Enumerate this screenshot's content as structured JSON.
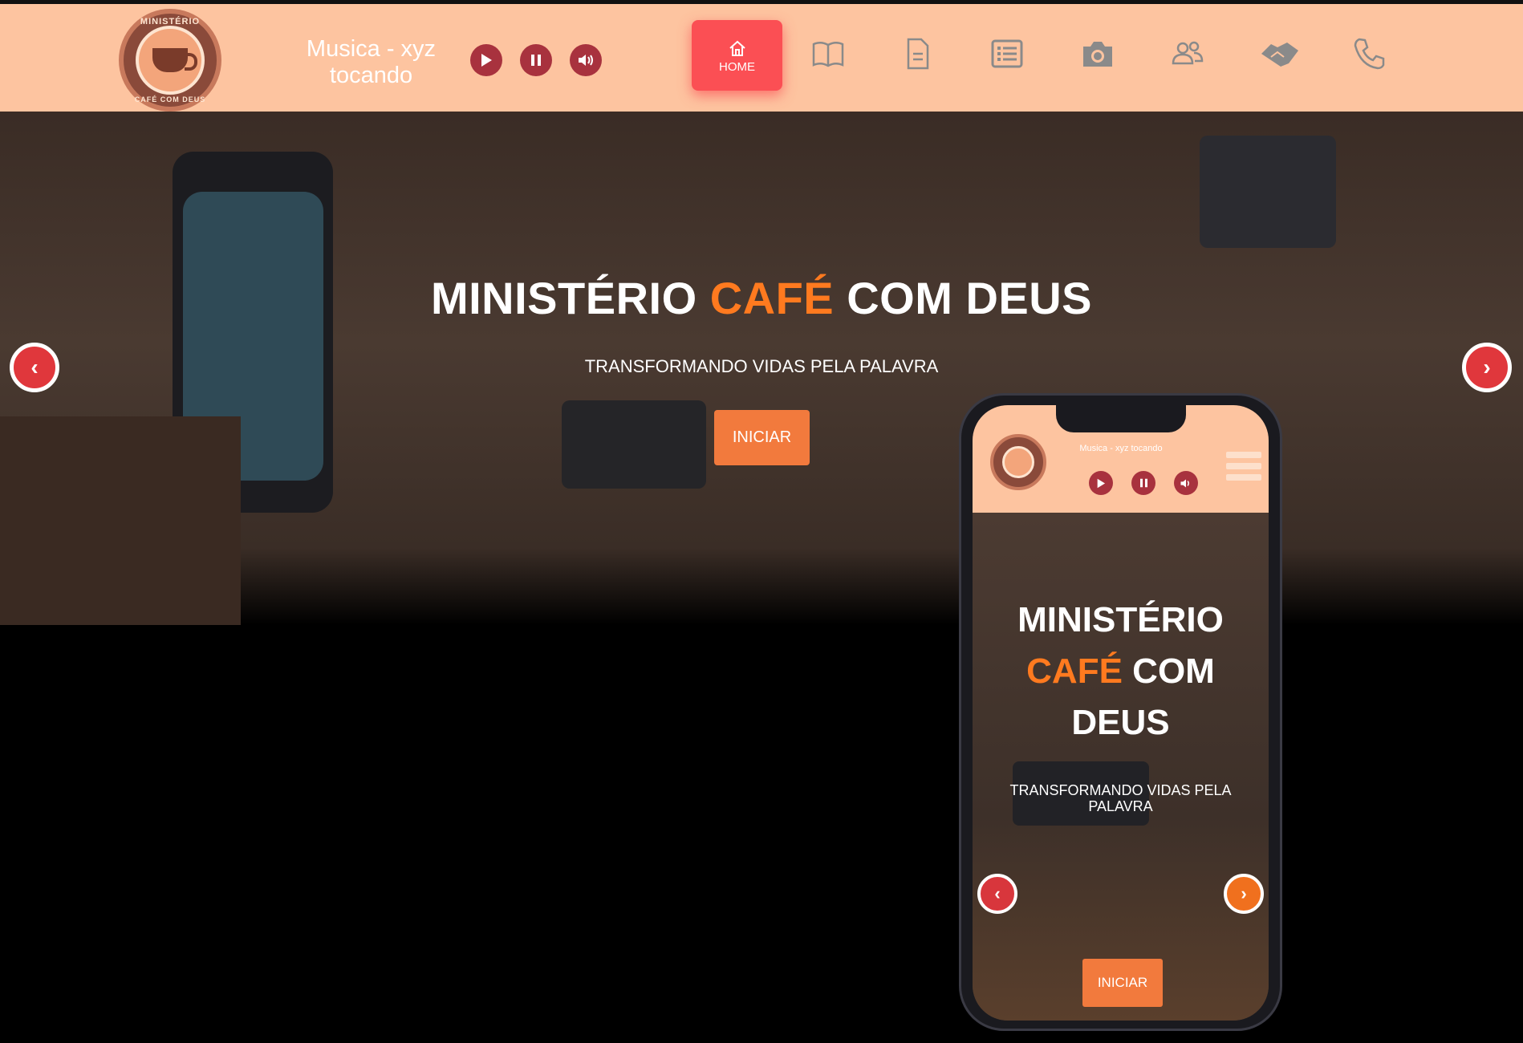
{
  "header": {
    "logo_top_text": "MINISTÉRIO",
    "logo_bottom_text": "CAFÉ COM DEUS",
    "now_playing": "Musica - xyz tocando",
    "controls": {
      "play_icon": "play-icon",
      "pause_icon": "pause-icon",
      "volume_icon": "volume-icon"
    },
    "nav": [
      {
        "label": "HOME",
        "icon": "home-icon",
        "active": true
      },
      {
        "label": "",
        "icon": "book-icon"
      },
      {
        "label": "",
        "icon": "document-icon"
      },
      {
        "label": "",
        "icon": "list-icon"
      },
      {
        "label": "",
        "icon": "camera-icon"
      },
      {
        "label": "",
        "icon": "users-icon"
      },
      {
        "label": "",
        "icon": "handshake-icon"
      },
      {
        "label": "",
        "icon": "phone-icon"
      }
    ]
  },
  "hero": {
    "title_part1": "MINISTÉRIO",
    "title_part2": "CAFÉ",
    "title_part3": "COM DEUS",
    "subtitle": "TRANSFORMANDO VIDAS PELA PALAVRA",
    "button_label": "INICIAR",
    "prev_icon": "chevron-left-icon",
    "next_icon": "chevron-right-icon"
  },
  "mobile_preview": {
    "now_playing": "Musica - xyz tocando",
    "title_part1": "MINISTÉRIO",
    "title_part2": "CAFÉ",
    "title_part3": "COM",
    "title_part4": "DEUS",
    "subtitle": "TRANSFORMANDO VIDAS PELA PALAVRA",
    "button_label": "INICIAR"
  },
  "colors": {
    "header_bg": "#fdc4a0",
    "accent_red": "#fb4f54",
    "control_red": "#a8323e",
    "orange": "#ff7a1f",
    "button_orange": "#f27a3d"
  }
}
